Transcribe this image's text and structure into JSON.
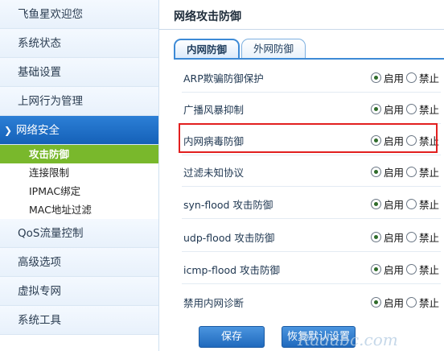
{
  "sidebar": {
    "items": [
      {
        "label": "飞鱼星欢迎您"
      },
      {
        "label": "系统状态"
      },
      {
        "label": "基础设置"
      },
      {
        "label": "上网行为管理"
      },
      {
        "label": "网络安全"
      },
      {
        "label": "QoS流量控制"
      },
      {
        "label": "高级选项"
      },
      {
        "label": "虚拟专网"
      },
      {
        "label": "系统工具"
      }
    ],
    "subitems": [
      {
        "label": "攻击防御"
      },
      {
        "label": "连接限制"
      },
      {
        "label": "IPMAC绑定"
      },
      {
        "label": "MAC地址过滤"
      }
    ]
  },
  "main": {
    "title": "网络攻击防御",
    "tabs": [
      {
        "label": "内网防御"
      },
      {
        "label": "外网防御"
      }
    ],
    "enable_label": "启用",
    "disable_label": "禁止",
    "rows": [
      {
        "label": "ARP欺骗防御保护",
        "value": "启用"
      },
      {
        "label": "广播风暴抑制",
        "value": "启用"
      },
      {
        "label": "内网病毒防御",
        "value": "启用"
      },
      {
        "label": "过滤未知协议",
        "value": "启用"
      },
      {
        "label": "syn-flood 攻击防御",
        "value": "启用"
      },
      {
        "label": "udp-flood 攻击防御",
        "value": "启用"
      },
      {
        "label": "icmp-flood 攻击防御",
        "value": "启用"
      },
      {
        "label": "禁用内网诊断",
        "value": "启用"
      }
    ],
    "save_label": "保存",
    "restore_label": "恢复默认设置"
  },
  "watermark": "Radabc.com",
  "colors": {
    "accent": "#1f69bd",
    "active_sub": "#79b82c",
    "highlight": "#e21f1f"
  }
}
